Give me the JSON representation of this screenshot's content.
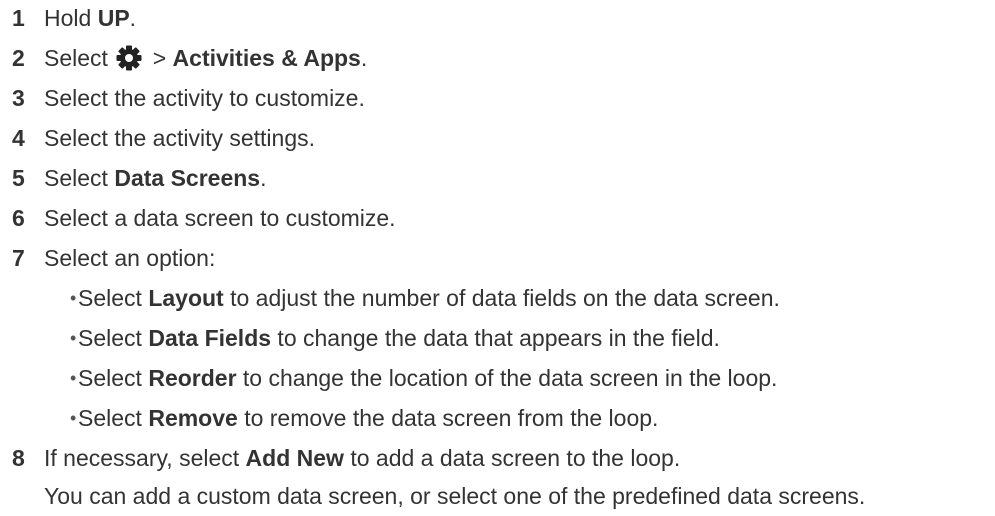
{
  "steps": [
    {
      "num": "1",
      "pre": "Hold ",
      "bold": "UP",
      "post": "."
    },
    {
      "num": "2",
      "pre": "Select ",
      "icon": "gear-icon",
      "sep": " > ",
      "bold": "Activities & Apps",
      "post": "."
    },
    {
      "num": "3",
      "text": "Select the activity to customize."
    },
    {
      "num": "4",
      "text": "Select the activity settings."
    },
    {
      "num": "5",
      "pre": "Select ",
      "bold": "Data Screens",
      "post": "."
    },
    {
      "num": "6",
      "text": "Select a data screen to customize."
    },
    {
      "num": "7",
      "text": "Select an option:"
    },
    {
      "num": "8",
      "pre": "If necessary, select ",
      "bold": "Add New",
      "post": " to add a data screen to the loop."
    }
  ],
  "options": [
    {
      "pre": "Select ",
      "bold": "Layout",
      "post": " to adjust the number of data fields on the data screen."
    },
    {
      "pre": "Select ",
      "bold": "Data Fields",
      "post": " to change the data that appears in the field."
    },
    {
      "pre": "Select ",
      "bold": "Reorder",
      "post": " to change the location of the data screen in the loop."
    },
    {
      "pre": "Select ",
      "bold": "Remove",
      "post": " to remove the data screen from the loop."
    }
  ],
  "bullet_char": "•",
  "note": "You can add a custom data screen, or select one of the predefined data screens."
}
